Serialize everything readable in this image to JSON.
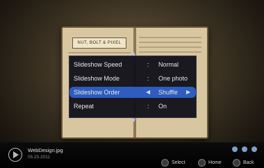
{
  "menu": {
    "rows": [
      {
        "label": "Slideshow Speed",
        "sep": ":",
        "value": "Normal"
      },
      {
        "label": "Slideshow  Mode",
        "sep": ":",
        "value": "One photo"
      },
      {
        "label": "Slideshow Order",
        "sep": "",
        "value": "Shuffle"
      },
      {
        "label": "Repeat",
        "sep": ":",
        "value": "On"
      }
    ]
  },
  "book": {
    "logo": "NUT, BOLT & PIXEL"
  },
  "footer": {
    "file": "WebDesign.jpg",
    "date": "05.25.2011",
    "select": "Select",
    "home": "Home",
    "back": "Back"
  }
}
